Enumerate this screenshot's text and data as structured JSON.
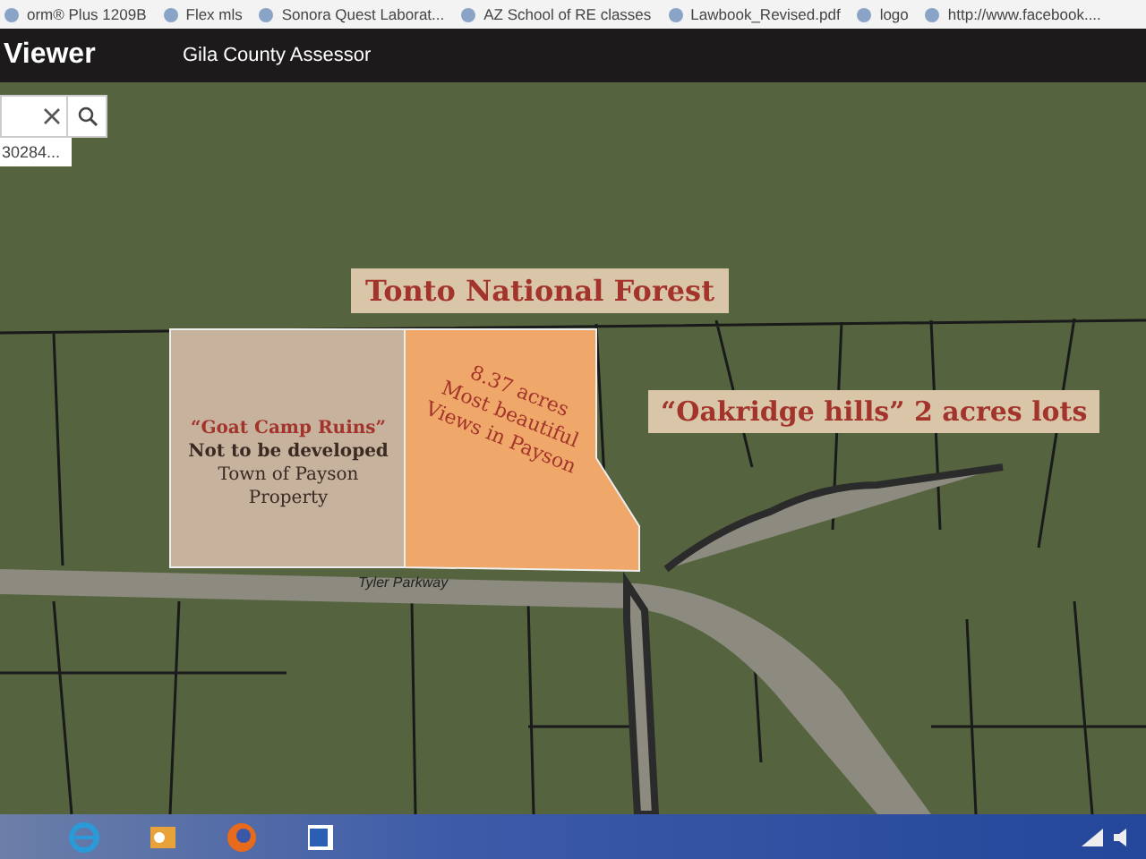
{
  "bookmarks": [
    {
      "label": "orm® Plus 1209B"
    },
    {
      "label": "Flex mls"
    },
    {
      "label": "Sonora Quest Laborat..."
    },
    {
      "label": "AZ School of RE classes"
    },
    {
      "label": "Lawbook_Revised.pdf"
    },
    {
      "label": "logo"
    },
    {
      "label": "http://www.facebook...."
    }
  ],
  "header": {
    "title": "Viewer",
    "subtitle": "Gila County Assessor"
  },
  "search": {
    "result": "30284..."
  },
  "map": {
    "labels": [
      {
        "kind": "banner",
        "lines": [
          "Tonto National Forest"
        ]
      },
      {
        "kind": "parcel",
        "lines": [
          "“Goat Camp Ruins”",
          "Not to be developed",
          "Town of Payson",
          "Property"
        ]
      },
      {
        "kind": "acreage",
        "lines": [
          "8.37 acres",
          "Most beautiful",
          "Views in Payson"
        ]
      },
      {
        "kind": "lots",
        "lines": [
          "“Oakridge hills” 2 acres lots"
        ]
      },
      {
        "kind": "road",
        "lines": [
          "Tyler Parkway"
        ]
      }
    ]
  },
  "taskbar": {
    "apps": [
      {
        "kind": "ie"
      },
      {
        "kind": "outlook"
      },
      {
        "kind": "firefox"
      },
      {
        "kind": "word"
      }
    ]
  }
}
